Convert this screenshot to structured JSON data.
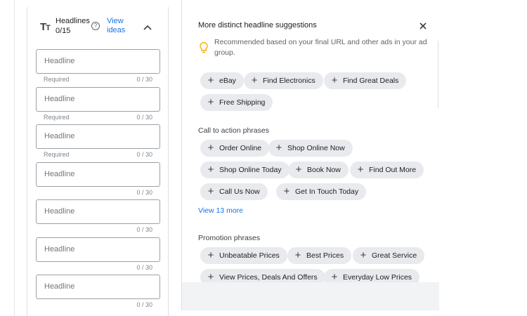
{
  "headlines_card": {
    "title": "Headlines",
    "count": "0/15",
    "view_ideas": "View\nideas",
    "fields": [
      {
        "placeholder": "Headline",
        "helper": "Required",
        "counter": "0 / 30"
      },
      {
        "placeholder": "Headline",
        "helper": "Required",
        "counter": "0 / 30"
      },
      {
        "placeholder": "Headline",
        "helper": "Required",
        "counter": "0 / 30"
      },
      {
        "placeholder": "Headline",
        "helper": "",
        "counter": "0 / 30"
      },
      {
        "placeholder": "Headline",
        "helper": "",
        "counter": "0 / 30"
      },
      {
        "placeholder": "Headline",
        "helper": "",
        "counter": "0 / 30"
      },
      {
        "placeholder": "Headline",
        "helper": "",
        "counter": "0 / 30"
      }
    ]
  },
  "suggestions_panel": {
    "title": "More distinct headline suggestions",
    "recommendation": "Recommended based on your final URL and other ads in your ad group.",
    "keyword_chips": [
      "eBay",
      "Find Electronics",
      "Find Great Deals",
      "Free Shipping"
    ],
    "cta_title": "Call to action phrases",
    "cta_chips": [
      "Order Online",
      "Shop Online Now",
      "Shop Online Today",
      "Book Now",
      "Find Out More",
      "Call Us Now",
      "Get In Touch Today"
    ],
    "view_more": "View 13 more",
    "promo_title": "Promotion phrases",
    "promo_chips": [
      "Unbeatable Prices",
      "Best Prices",
      "Great Service",
      "View Prices, Deals And Offers",
      "Everyday Low Prices"
    ]
  },
  "icons": {
    "text_format": "text-format-icon",
    "help": "help-icon",
    "collapse": "chevron-up-icon",
    "close": "close-icon",
    "bulb": "lightbulb-icon",
    "plus": "plus-icon"
  },
  "colors": {
    "link": "#1a73e8",
    "chip_bg": "#e8eaed",
    "bulb": "#f9ab00"
  }
}
